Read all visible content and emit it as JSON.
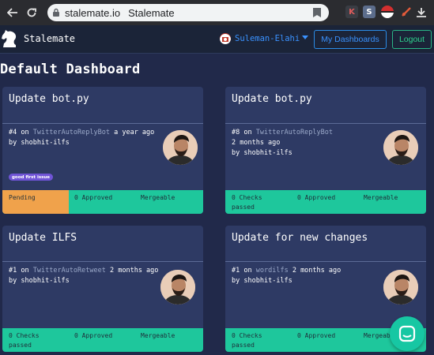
{
  "browser": {
    "url": "stalemate.io",
    "page_title": "Stalemate",
    "extensions": [
      {
        "name": "k-extension-icon",
        "glyph": "K",
        "bg": "#3a3d44",
        "fg": "#e05c5c"
      },
      {
        "name": "s-extension-icon",
        "glyph": "S",
        "bg": "#5c6d8c",
        "fg": "#ffffff"
      },
      {
        "name": "pokeball-extension-icon",
        "glyph": "",
        "bg": "#c62828",
        "fg": "#ffffff"
      },
      {
        "name": "blocked-extension-icon",
        "glyph": "",
        "bg": "#2b2c30",
        "fg": "#e25a3a"
      }
    ]
  },
  "header": {
    "brand": "Stalemate",
    "username": "Suleman-Elahi",
    "dashboards_button": "My Dashboards",
    "logout_button": "Logout"
  },
  "page": {
    "title": "Default Dashboard"
  },
  "cards": [
    {
      "title": "Update bot.py",
      "number": "#4",
      "on": "on",
      "repo": "TwitterAutoReplyBot",
      "age": "a year ago",
      "by_prefix": "by",
      "author": "shobhit-ilfs",
      "label": "good first issue",
      "status": [
        "Pending",
        "0 Approved",
        "Mergeable"
      ]
    },
    {
      "title": "Update bot.py",
      "number": "#8",
      "on": "on",
      "repo": "TwitterAutoReplyBot",
      "age": "2 months ago",
      "by_prefix": "by",
      "author": "shobhit-ilfs",
      "status": [
        "0 Checks passed",
        "0 Approved",
        "Mergeable"
      ]
    },
    {
      "title": "Update ILFS",
      "number": "#1",
      "on": "on",
      "repo": "TwitterAutoRetweet",
      "age": "2 months ago",
      "by_prefix": "by",
      "author": "shobhit-ilfs",
      "status": [
        "0 Checks passed",
        "0 Approved",
        "Mergeable"
      ]
    },
    {
      "title": "Update for new changes",
      "number": "#1",
      "on": "on",
      "repo": "wordilfs",
      "age": "2 months ago",
      "by_prefix": "by",
      "author": "shobhit-ilfs",
      "status": [
        "0 Checks passed",
        "0 Approved",
        "Mergeable"
      ]
    }
  ],
  "colors": {
    "background": "#21294a",
    "card": "#2e3a64",
    "status_green": "#1ec79c",
    "pending_orange": "#f0a24b",
    "link_blue": "#3a92ff",
    "logout_green": "#2fd28e"
  }
}
